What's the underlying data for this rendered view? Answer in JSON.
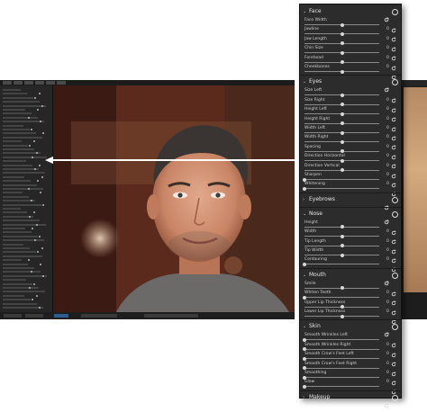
{
  "panel": {
    "sections": [
      {
        "title": "Face",
        "expanded": true,
        "rows": [
          {
            "label": "Face Width",
            "value": "0",
            "level": 0.5
          },
          {
            "label": "Jawline",
            "value": "0",
            "level": 0.5
          },
          {
            "label": "Jaw Length",
            "value": "0",
            "level": 0.5
          },
          {
            "label": "Chin Size",
            "value": "0",
            "level": 0.5
          },
          {
            "label": "Forehead",
            "value": "0",
            "level": 0.5
          },
          {
            "label": "Cheekbones",
            "value": "0",
            "level": 0.5
          }
        ]
      },
      {
        "title": "Eyes",
        "expanded": true,
        "rows": [
          {
            "label": "Size Left",
            "value": "0",
            "level": 0.5
          },
          {
            "label": "Size Right",
            "value": "0",
            "level": 0.5
          },
          {
            "label": "Height Left",
            "value": "0",
            "level": 0.5
          },
          {
            "label": "Height Right",
            "value": "0",
            "level": 0.5
          },
          {
            "label": "Width Left",
            "value": "0",
            "level": 0.5
          },
          {
            "label": "Width Right",
            "value": "0",
            "level": 0.5
          },
          {
            "label": "Spacing",
            "value": "0",
            "level": 0.5
          },
          {
            "label": "Direction Horizontal",
            "value": "0",
            "level": 0.5
          },
          {
            "label": "Direction Vertical",
            "value": "0",
            "level": 0.5
          },
          {
            "label": "Sharpen",
            "value": "0",
            "level": 0.0
          },
          {
            "label": "Whitening",
            "value": "0",
            "level": 0.0
          }
        ]
      },
      {
        "title": "Eyebrows",
        "expanded": false,
        "rows": []
      },
      {
        "title": "Nose",
        "expanded": true,
        "rows": [
          {
            "label": "Height",
            "value": "0",
            "level": 0.5
          },
          {
            "label": "Width",
            "value": "0",
            "level": 0.5
          },
          {
            "label": "Tip Length",
            "value": "0",
            "level": 0.5
          },
          {
            "label": "Tip Width",
            "value": "0",
            "level": 0.5
          },
          {
            "label": "Contouring",
            "value": "0",
            "level": 0.0
          }
        ]
      },
      {
        "title": "Mouth",
        "expanded": true,
        "rows": [
          {
            "label": "Smile",
            "value": "0",
            "level": 0.5
          },
          {
            "label": "Whiten Teeth",
            "value": "0",
            "level": 0.0
          },
          {
            "label": "Upper Lip Thickness",
            "value": "0",
            "level": 0.5
          },
          {
            "label": "Lower Lip Thickness",
            "value": "0",
            "level": 0.5
          }
        ]
      },
      {
        "title": "Skin",
        "expanded": true,
        "rows": [
          {
            "label": "Smooth Wrinkles Left",
            "value": "0",
            "level": 0.0
          },
          {
            "label": "Smooth Wrinkles Right",
            "value": "0",
            "level": 0.0
          },
          {
            "label": "Smooth Crow's Feet Left",
            "value": "0",
            "level": 0.0
          },
          {
            "label": "Smooth Crow's Feet Right",
            "value": "0",
            "level": 0.0
          },
          {
            "label": "Smoothing",
            "value": "0",
            "level": 0.0
          },
          {
            "label": "Glow",
            "value": "0",
            "level": 0.0
          }
        ]
      },
      {
        "title": "Makeup",
        "expanded": false,
        "rows": []
      }
    ]
  },
  "colors": {
    "panel_bg": "#2c2c2c",
    "arrow": "#ffffff",
    "accent": "#2d5c8e"
  },
  "icons": {
    "section_reset": "reset-icon",
    "section_toggle": "toggle-icon",
    "expanded": "chevron-down-icon",
    "collapsed": "chevron-right-icon"
  }
}
